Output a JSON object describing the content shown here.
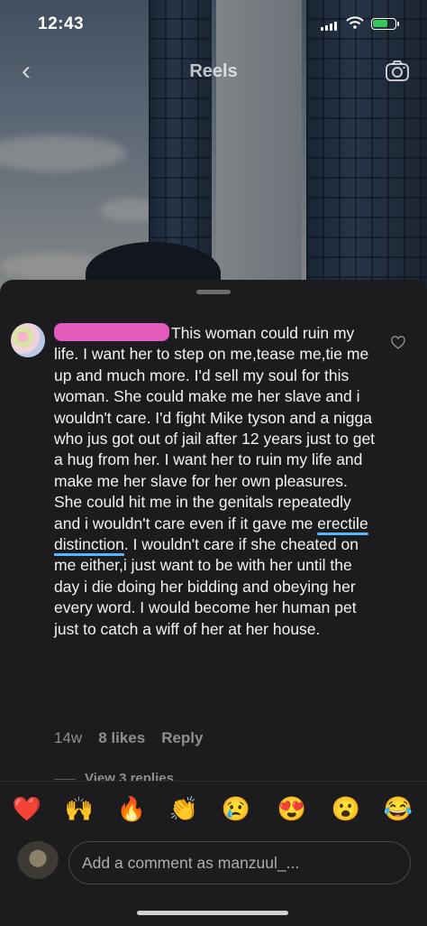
{
  "status_bar": {
    "time": "12:43"
  },
  "header": {
    "title": "Reels",
    "back_icon": "chevron-left-icon",
    "camera_icon": "camera-icon"
  },
  "comment": {
    "redacted_username": "",
    "text_before": "This woman could ruin my life. I want her to step on me,tease me,tie me up and much more. I'd sell my soul for this woman. She could make me her slave and i wouldn't care. I'd fight Mike tyson and a nigga who jus got out of jail after 12 years just to get a hug from her. I want her to ruin my life and make me her slave for her own pleasures. She could hit me in the genitals repeatedly and i wouldn't care even if it gave me ",
    "text_underlined": "erectile distinction",
    "text_after": ". I wouldn't care if she cheated on me either,i just want to be with her until the day i die doing her bidding and obeying her every word. I would become her human pet just to catch a wiff of her at her house.",
    "age": "14w",
    "likes": "8 likes",
    "reply_label": "Reply",
    "view_replies": "View 3 replies",
    "highlight_color": "#e35bbd",
    "underline_color": "#5ab4ff"
  },
  "reactions": [
    "❤️",
    "🙌",
    "🔥",
    "👏",
    "😢",
    "😍",
    "😮",
    "😂"
  ],
  "composer": {
    "placeholder": "Add a comment as manzuul_..."
  }
}
